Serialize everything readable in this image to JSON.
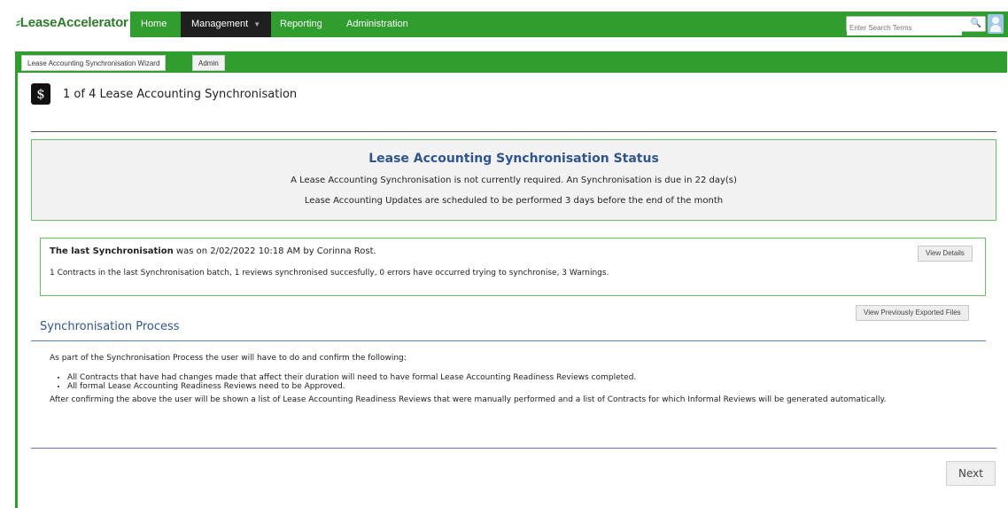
{
  "app": {
    "logo_text": "LeaseAccelerator",
    "nav": [
      {
        "label": "Home"
      },
      {
        "label": "Management"
      },
      {
        "label": "Reporting"
      },
      {
        "label": "Administration"
      }
    ],
    "search_placeholder": "Enter Search Terms"
  },
  "tabs": [
    {
      "label": "Lease Accounting Synchronisation Wizard"
    },
    {
      "label": "Admin"
    }
  ],
  "step": {
    "icon": "$",
    "title": "1 of 4 Lease Accounting Synchronisation"
  },
  "status": {
    "title": "Lease Accounting Synchronisation Status",
    "line1": "A Lease Accounting Synchronisation is not currently required. An Synchronisation is due in 22 day(s)",
    "line2": "Lease Accounting Updates are scheduled to be performed 3 days before the end of the month"
  },
  "last_sync": {
    "bold": "The last Synchronisation",
    "rest": " was on 2/02/2022 10:18 AM by Corinna Rost.",
    "details": "1 Contracts in the last Synchronisation batch, 1 reviews synchronised succesfully, 0 errors have occurred trying to synchronise, 3 Warnings.",
    "view_details": "View Details",
    "view_exported": "View Previously Exported Files"
  },
  "process": {
    "title": "Synchronisation Process",
    "intro": "As part of the Synchronisation Process the user will have to do and confirm the following:",
    "bullets": [
      "All Contracts that have had changes made that affect their duration will need to have formal Lease Accounting Readiness Reviews completed.",
      "All formal Lease Accounting Readiness Reviews need to be Approved."
    ],
    "outro": "After confirming the above the user will be shown a list of Lease Accounting Readiness Reviews that were manually performed and a list of Contracts for which Informal Reviews will be generated automatically."
  },
  "next_label": "Next"
}
